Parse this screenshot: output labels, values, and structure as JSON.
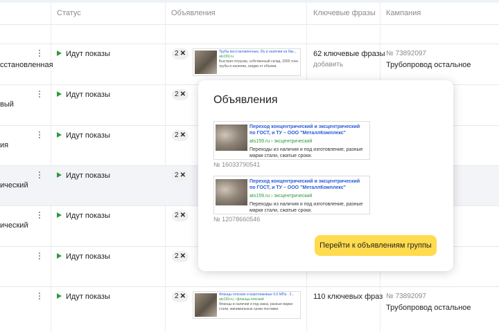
{
  "header": {
    "columns": [
      "Статус",
      "Объявления",
      "Ключевые фразы",
      "Кампания"
    ]
  },
  "rows": [
    {
      "name": "сстановленная",
      "status": "Идут показы",
      "ads_count": "2",
      "ad": {
        "title": "Трубы восстановленные, б/у в наличии на баз...",
        "url": "ats159.ru",
        "desc": "Быстрая отгрузка, собственный склад. 2000 тонн трубы в наличии, скидки от объема."
      },
      "keywords": "62 ключевые фразы",
      "keywords_add": "добавить",
      "campaign_num": "№ 73892097",
      "campaign_name": "Трубопровод остальное"
    },
    {
      "name": "вый",
      "status": "Идут показы",
      "ads_count": "2"
    },
    {
      "name": "ия",
      "status": "Идут показы",
      "ads_count": "2"
    },
    {
      "name": "ический",
      "status": "Идут показы",
      "ads_count": "2"
    },
    {
      "name": "ический",
      "status": "Идут показы",
      "ads_count": "2"
    },
    {
      "name": "",
      "status": "Идут показы",
      "ads_count": "2"
    },
    {
      "name": "",
      "status": "Идут показы",
      "ads_count": "2",
      "ad": {
        "title": "Фланцы плоские и воротниковые 0,6 МПа - 2...",
        "url": "ats159.ru › фланцы-плоский",
        "desc": "Фланцы в наличии и под заказ, разные марки стали, минимальные сроки поставки."
      },
      "keywords": "110 ключевых фраз",
      "campaign_num": "№ 73892097",
      "campaign_name": "Трубопровод остальное"
    }
  ],
  "popup": {
    "title": "Объявления",
    "ads": [
      {
        "title": "Переход концентрический и эксцентрический по ГОСТ, и ТУ – ООО \"МеталлКомплекс\"",
        "url": "ats159.ru › эксцентрический",
        "desc": "Переходы из наличия и под изготовление, разные марки стали, сжатые сроки.",
        "number": "№ 16033790541"
      },
      {
        "title": "Переход концентрический и эксцентрический по ГОСТ, и ТУ – ООО \"МеталлКомплекс\"",
        "url": "ats159.ru › эксцентрический",
        "desc": "Переходы из наличия и под изготовление, разные марки стали, сжатые сроки.",
        "number": "№ 12078660546"
      }
    ],
    "button": "Перейти к объявлениям группы"
  },
  "colors": {
    "accent_button": "#ffdb4d",
    "status_active": "#2e9a3c",
    "link_blue": "#2a5bd7",
    "url_green": "#2a9a3a"
  },
  "icons": {
    "status": "play-icon",
    "row_menu": "more-vert-icon",
    "ads_badge": "close-x-icon"
  }
}
